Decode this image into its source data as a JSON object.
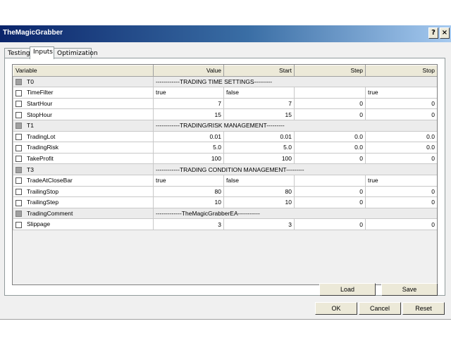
{
  "window": {
    "title": "TheMagicGrabber",
    "help_glyph": "?",
    "close_glyph": "×"
  },
  "tabs": [
    {
      "label": "Testing",
      "active": false
    },
    {
      "label": "Inputs",
      "active": true
    },
    {
      "label": "Optimization",
      "active": false
    }
  ],
  "table": {
    "headers": [
      "Variable",
      "Value",
      "Start",
      "Step",
      "Stop"
    ],
    "rows": [
      {
        "group": true,
        "name": "T0",
        "separator": "------------TRADING TIME SETTINGS---------"
      },
      {
        "group": false,
        "name": "TimeFilter",
        "value": "true",
        "start": "false",
        "step": "",
        "stop": "true",
        "text": true
      },
      {
        "group": false,
        "name": "StartHour",
        "value": "7",
        "start": "7",
        "step": "0",
        "stop": "0"
      },
      {
        "group": false,
        "name": "StopHour",
        "value": "15",
        "start": "15",
        "step": "0",
        "stop": "0"
      },
      {
        "group": true,
        "name": "T1",
        "separator": "------------TRADING/RISK MANAGEMENT---------"
      },
      {
        "group": false,
        "name": "TradingLot",
        "value": "0.01",
        "start": "0.01",
        "step": "0.0",
        "stop": "0.0"
      },
      {
        "group": false,
        "name": "TradingRisk",
        "value": "5.0",
        "start": "5.0",
        "step": "0.0",
        "stop": "0.0"
      },
      {
        "group": false,
        "name": "TakeProfit",
        "value": "100",
        "start": "100",
        "step": "0",
        "stop": "0"
      },
      {
        "group": true,
        "name": "T3",
        "separator": "------------TRADING CONDITION MANAGEMENT---------"
      },
      {
        "group": false,
        "name": "TradeAtCloseBar",
        "value": "true",
        "start": "false",
        "step": "",
        "stop": "true",
        "text": true
      },
      {
        "group": false,
        "name": "TrailingStop",
        "value": "80",
        "start": "80",
        "step": "0",
        "stop": "0"
      },
      {
        "group": false,
        "name": "TrailingStep",
        "value": "10",
        "start": "10",
        "step": "0",
        "stop": "0"
      },
      {
        "group": true,
        "name": "TradingComment",
        "separator": "-------------TheMagicGrabberEA-----------"
      },
      {
        "group": false,
        "name": "Slippage",
        "value": "3",
        "start": "3",
        "step": "0",
        "stop": "0"
      }
    ]
  },
  "buttons": {
    "load": "Load",
    "save": "Save",
    "ok": "OK",
    "cancel": "Cancel",
    "reset": "Reset"
  },
  "colors": {
    "titlebar_start": "#0a246a",
    "titlebar_end": "#a6caf0"
  }
}
